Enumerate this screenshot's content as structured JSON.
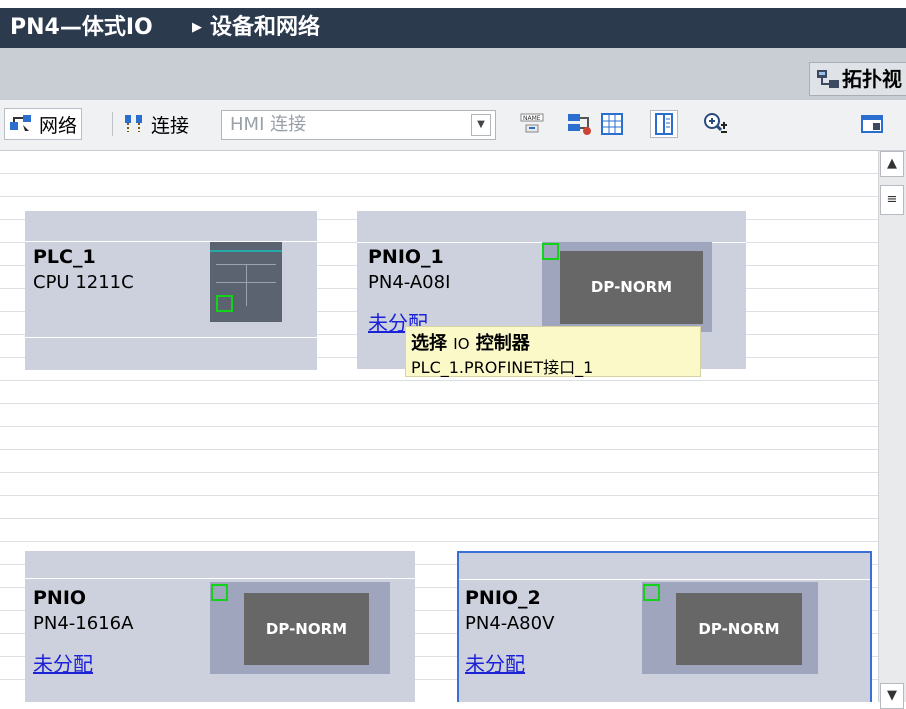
{
  "header": {
    "breadcrumb_root": "PN4—体式IO",
    "breadcrumb_sep_icon": "right-triangle-icon",
    "breadcrumb_current": "设备和网络"
  },
  "view_tabs": {
    "topology_label": "拓扑视"
  },
  "toolbar": {
    "network_label": "网络",
    "connection_label": "连接",
    "hmi_connection_placeholder": "HMI 连接",
    "icons": [
      "network-view-icon",
      "connection-icon",
      "dropdown-arrow-icon",
      "name-icon",
      "tag-icon",
      "grid-icon",
      "list-icon",
      "zoom-in-icon",
      "properties-panel-icon"
    ]
  },
  "devices": [
    {
      "name": "PLC_1",
      "order": "CPU 1211C"
    },
    {
      "name": "PNIO_1",
      "order": "PN4-A08I",
      "assignment": "未分配",
      "module_label": "DP-NORM"
    },
    {
      "name": "PNIO",
      "order": "PN4-1616A",
      "assignment": "未分配",
      "module_label": "DP-NORM"
    },
    {
      "name": "PNIO_2",
      "order": "PN4-A80V",
      "assignment": "未分配",
      "module_label": "DP-NORM"
    }
  ],
  "tooltip": {
    "title_pre": "选择",
    "title_io": "IO",
    "title_post": "控制器",
    "option": "PLC_1.PROFINET接口_1"
  },
  "colors": {
    "title_bar": "#2c3a4e",
    "device_bg": "#cdd0dd",
    "module_bg": "#676767",
    "port_green": "#12d21a",
    "link_blue": "#1b22d8",
    "selected_border": "#3b6fd6",
    "tooltip_bg": "#fcf9c9"
  }
}
